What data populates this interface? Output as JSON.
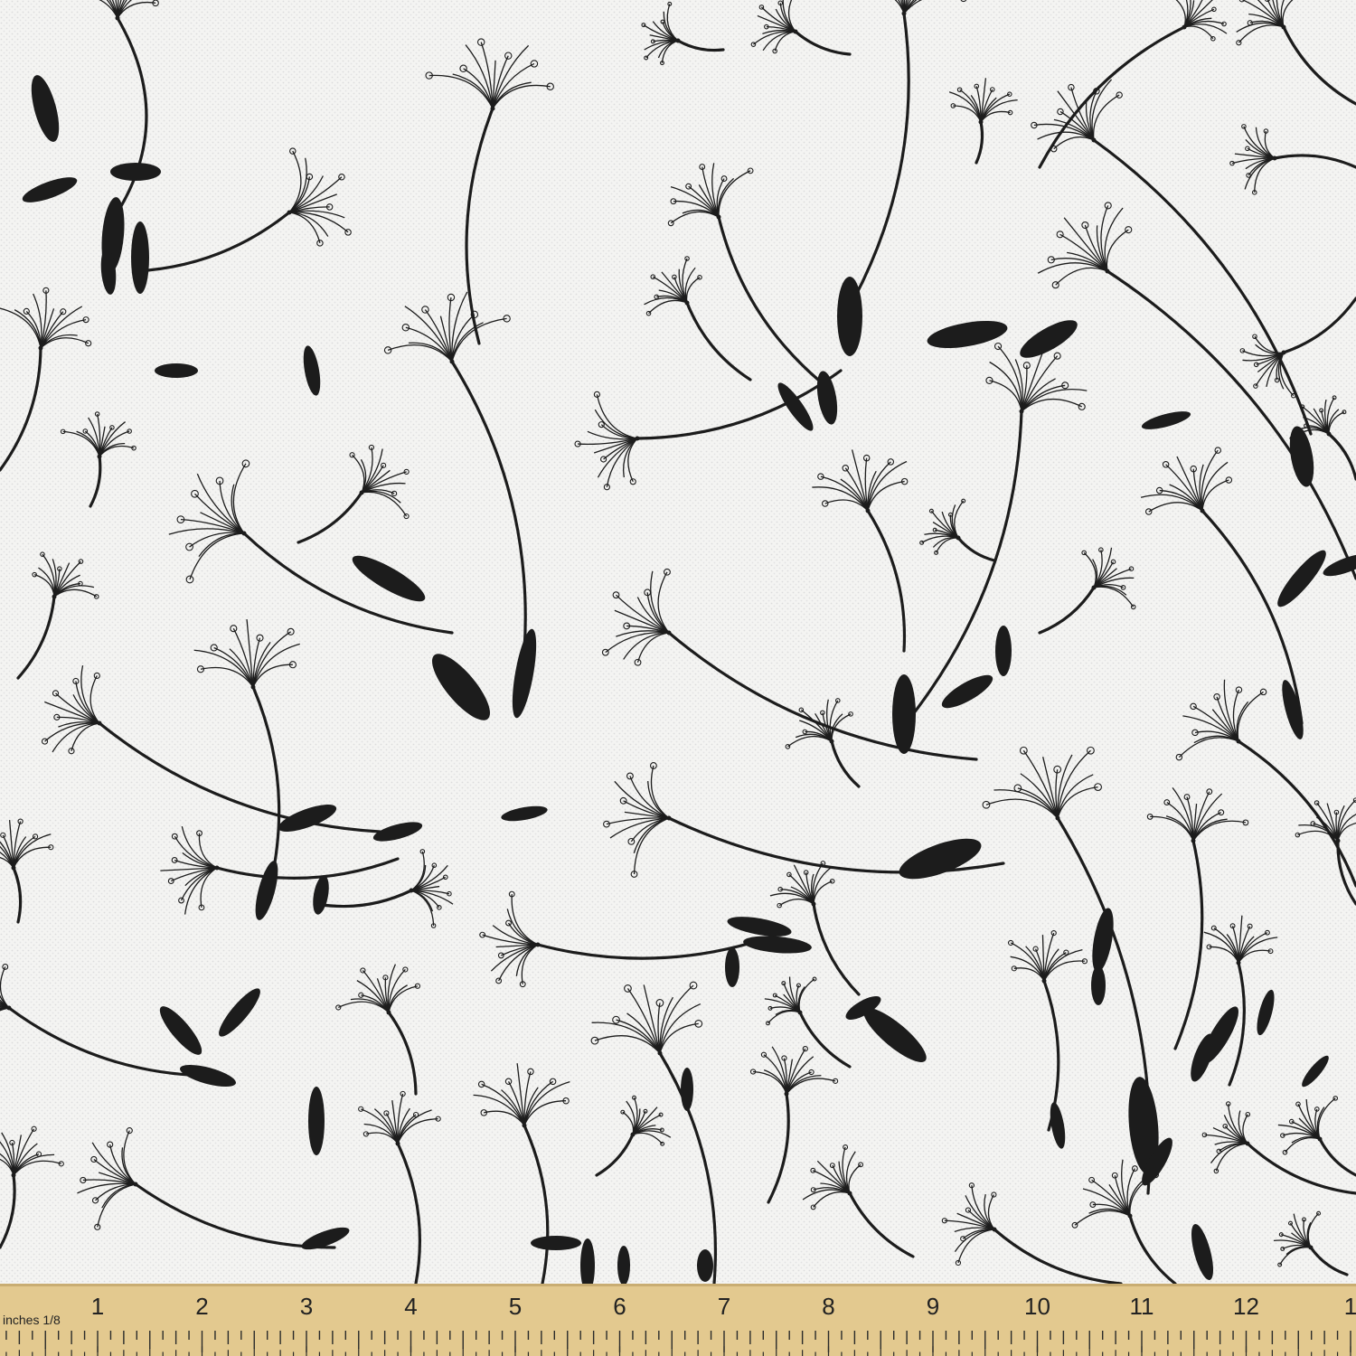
{
  "fabric_swatch": {
    "motif": "dandelion seeds",
    "background_color": "#f4f4f2",
    "ink_color": "#1c1c1c"
  },
  "ruler": {
    "numerals": [
      "1",
      "2",
      "3",
      "4",
      "5",
      "6",
      "7",
      "8",
      "9",
      "10",
      "11",
      "12",
      "1"
    ],
    "unit_label": "inches 1/8",
    "color": "#e3c98f",
    "tick_color": "#2a2a2a"
  }
}
